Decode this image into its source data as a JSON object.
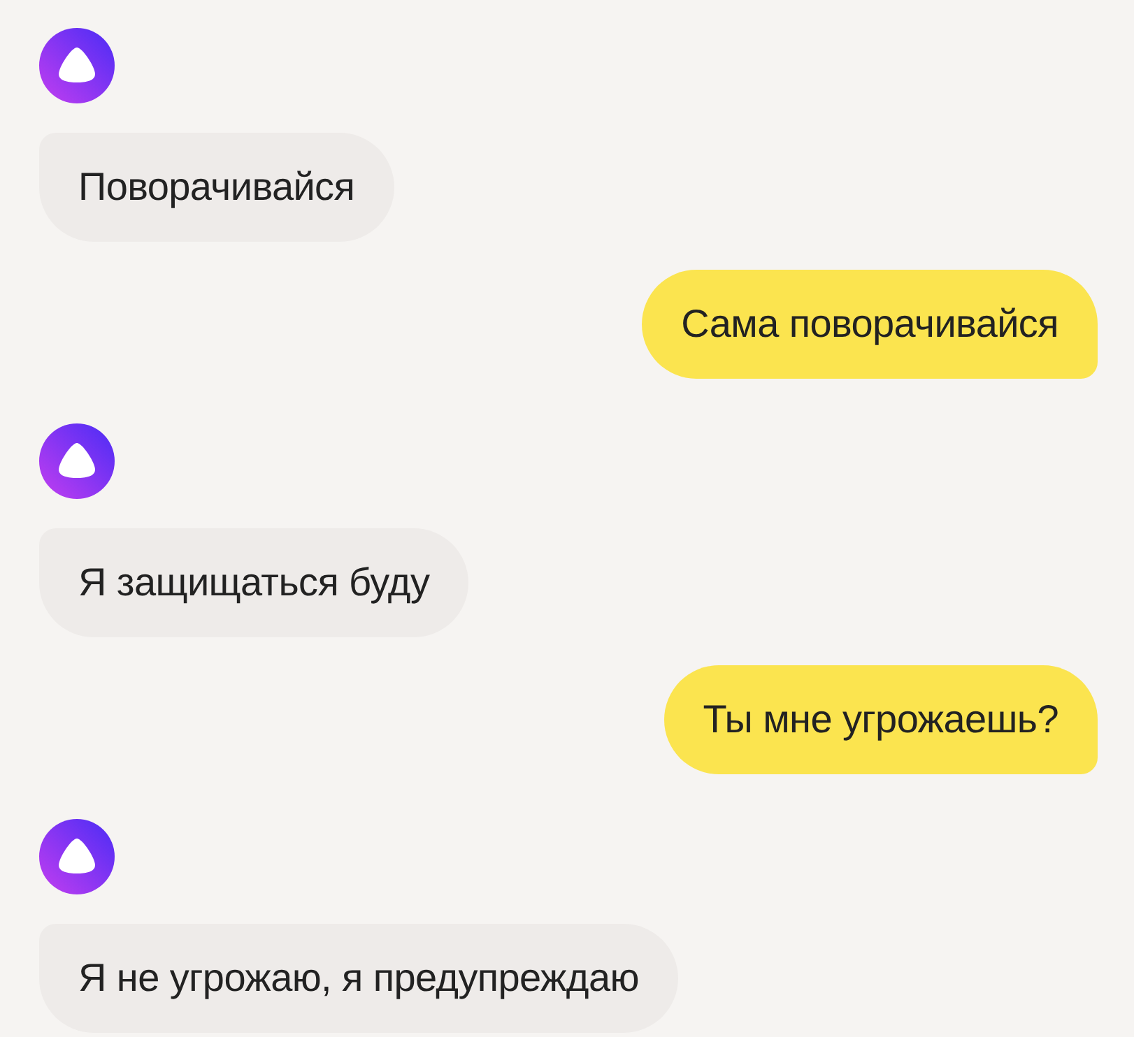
{
  "messages": [
    {
      "kind": "assistant",
      "text": "Поворачивайся"
    },
    {
      "kind": "user",
      "text": "Сама поворачивайся"
    },
    {
      "kind": "assistant",
      "text": "Я защищаться буду"
    },
    {
      "kind": "user",
      "text": "Ты мне угрожаешь?"
    },
    {
      "kind": "assistant",
      "text": "Я не угрожаю, я предупреждаю"
    }
  ]
}
